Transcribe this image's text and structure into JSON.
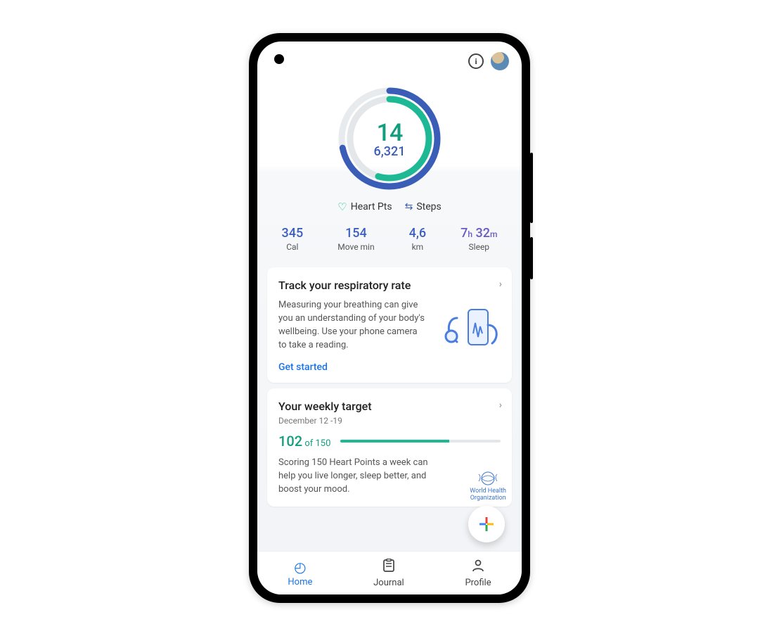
{
  "ring": {
    "heart_pts": "14",
    "steps": "6,321"
  },
  "legend": {
    "heart": "Heart Pts",
    "steps": "Steps"
  },
  "stats": {
    "cal": {
      "value": "345",
      "label": "Cal"
    },
    "move": {
      "value": "154",
      "label": "Move min"
    },
    "km": {
      "value": "4,6",
      "label": "km"
    },
    "sleep": {
      "value_h": "7",
      "unit_h": "h",
      "value_m": "32",
      "unit_m": "m",
      "label": "Sleep"
    }
  },
  "card_resp": {
    "title": "Track your respiratory rate",
    "body": "Measuring your breathing can give you an understanding of your body's wellbeing. Use your phone camera to take a reading.",
    "cta": "Get started"
  },
  "card_target": {
    "title": "Your weekly target",
    "date": "December 12 -19",
    "value": "102",
    "of": " of 150",
    "body": "Scoring 150 Heart Points a week can help you live longer, sleep better, and boost your mood.",
    "who1": "World Health",
    "who2": "Organization"
  },
  "nav": {
    "home": "Home",
    "journal": "Journal",
    "profile": "Profile"
  }
}
